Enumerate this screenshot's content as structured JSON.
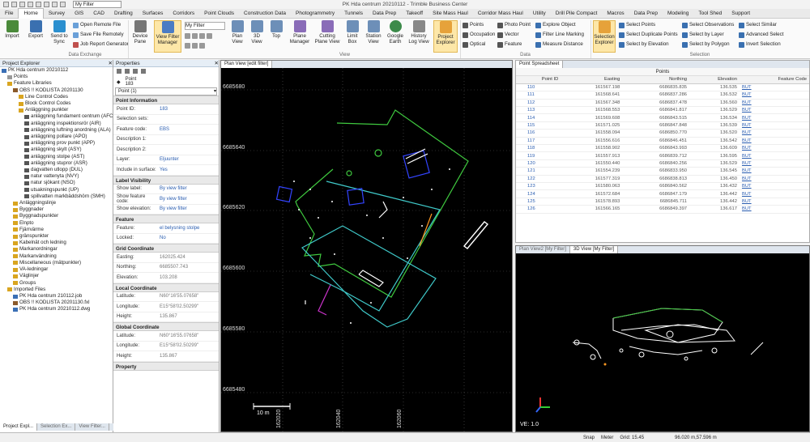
{
  "app": {
    "title": "PK Hda centrum 20210112 - Trimble Business Center",
    "filter": "My Filter"
  },
  "menu": [
    "File",
    "Home",
    "Survey",
    "GIS",
    "CAD",
    "Drafting",
    "Surfaces",
    "Corridors",
    "Point Clouds",
    "Construction Data",
    "Photogrammetry",
    "Tunnels",
    "Data Prep",
    "Takeoff",
    "Site Mass Haul",
    "Corridor Mass Haul",
    "Utility",
    "Drill Pile Compact",
    "Macros",
    "Data Prep",
    "Modeling",
    "Tool Shed",
    "Support"
  ],
  "ribbon": {
    "import": "Import",
    "export": "Export",
    "send": "Send to Sync",
    "remote": "Open Remote File",
    "save_remotely": "Save File Remotely",
    "job_report": "Job Report Generator",
    "device": "Device Pane",
    "view_filter": "View Filter Manager",
    "myfilter": "My Filter",
    "plan": "Plan View",
    "view3d": "3D View",
    "top": "Top",
    "plane_mgr": "Plane Manager",
    "cutting": "Cutting Plane View",
    "limit_box": "Limit Box",
    "station": "Station View",
    "gearth": "Google Earth",
    "history": "History Log View",
    "proj_exp": "Project Explorer",
    "points": "Points",
    "occupation": "Occupation",
    "optical": "Optical",
    "photo_point": "Photo Point",
    "vector": "Vector",
    "feature": "Feature",
    "explore_obj": "Explore Object",
    "filter_line": "Filter Line Marking",
    "measure_dist": "Measure Distance",
    "selection_exp": "Selection Explorer",
    "sel_points": "Select Points",
    "sel_dup": "Select Duplicate Points",
    "sel_elev": "Select by Elevation",
    "sel_obs": "Select Observations",
    "sel_layer": "Select by Layer",
    "sel_poly": "Select by Polygon",
    "sel_similar": "Select Similar",
    "adv_sel": "Advanced Select",
    "inv_sel": "Invert Selection",
    "grp_data_exchange": "Data Exchange",
    "grp_view": "View",
    "grp_data": "Data",
    "grp_selection": "Selection"
  },
  "project_explorer": {
    "title": "Project Explorer",
    "items": [
      {
        "t": "PK Hda centrum 20210112",
        "lvl": 0,
        "c": "#3a6fb5"
      },
      {
        "t": "Points",
        "lvl": 1,
        "c": "#999"
      },
      {
        "t": "Feature Libraries",
        "lvl": 1,
        "c": "#d9a520"
      },
      {
        "t": "OBS !! KODLISTA 20201130",
        "lvl": 2,
        "c": "#8b5a2b"
      },
      {
        "t": "Line Control Codes",
        "lvl": 3,
        "c": "#d9a520"
      },
      {
        "t": "Block Control Codes",
        "lvl": 3,
        "c": "#d9a520"
      },
      {
        "t": "Anläggning punkter",
        "lvl": 3,
        "c": "#d9a520"
      },
      {
        "t": "anläggning fundament centrum (AFC)",
        "lvl": 4,
        "c": "#555"
      },
      {
        "t": "anläggning inspektionsrör (AIR)",
        "lvl": 4,
        "c": "#555"
      },
      {
        "t": "anläggning luftning anordning (ALA)",
        "lvl": 4,
        "c": "#555"
      },
      {
        "t": "anläggning pollare (APO)",
        "lvl": 4,
        "c": "#555"
      },
      {
        "t": "anläggning prov punkt (APP)",
        "lvl": 4,
        "c": "#555"
      },
      {
        "t": "anläggning skylt (ASY)",
        "lvl": 4,
        "c": "#555"
      },
      {
        "t": "anläggning stolpe (AST)",
        "lvl": 4,
        "c": "#555"
      },
      {
        "t": "anläggning stupror (ASR)",
        "lvl": 4,
        "c": "#555"
      },
      {
        "t": "dagvatten utlopp (DUL)",
        "lvl": 4,
        "c": "#555"
      },
      {
        "t": "natur vattenyta (NVY)",
        "lvl": 4,
        "c": "#555"
      },
      {
        "t": "natur sjökant (NSO)",
        "lvl": 4,
        "c": "#555"
      },
      {
        "t": "utsakningspunkt (UP)",
        "lvl": 4,
        "c": "#555"
      },
      {
        "t": "spillvatten markbäddshörn (SMH)",
        "lvl": 4,
        "c": "#555"
      },
      {
        "t": "Anläggningslinje",
        "lvl": 2,
        "c": "#d9a520"
      },
      {
        "t": "Byggnader",
        "lvl": 2,
        "c": "#d9a520"
      },
      {
        "t": "Byggnadspunkter",
        "lvl": 2,
        "c": "#d9a520"
      },
      {
        "t": "Elnpto",
        "lvl": 2,
        "c": "#d9a520"
      },
      {
        "t": "Fjärrvärme",
        "lvl": 2,
        "c": "#d9a520"
      },
      {
        "t": "gränspunkter",
        "lvl": 2,
        "c": "#d9a520"
      },
      {
        "t": "Kabelnät och ledning",
        "lvl": 2,
        "c": "#d9a520"
      },
      {
        "t": "Markanordningar",
        "lvl": 2,
        "c": "#d9a520"
      },
      {
        "t": "Markanvändning",
        "lvl": 2,
        "c": "#d9a520"
      },
      {
        "t": "Miscellaneous (mätpunkter)",
        "lvl": 2,
        "c": "#d9a520"
      },
      {
        "t": "VA-ledningar",
        "lvl": 2,
        "c": "#d9a520"
      },
      {
        "t": "Väglinjer",
        "lvl": 2,
        "c": "#d9a520"
      },
      {
        "t": "Groups",
        "lvl": 2,
        "c": "#d9a520"
      },
      {
        "t": "Imported Files",
        "lvl": 1,
        "c": "#d9a520"
      },
      {
        "t": "PK Hda centrum 210112.job",
        "lvl": 2,
        "c": "#3a6fb5"
      },
      {
        "t": "OBS !! KODLISTA 20201130.fxl",
        "lvl": 2,
        "c": "#8b5a2b"
      },
      {
        "t": "PK Hda centrum 20210112.dwg",
        "lvl": 2,
        "c": "#3a6fb5"
      }
    ],
    "bottom_tabs": [
      "Project Expl...",
      "Selection Ex...",
      "View Filter..."
    ]
  },
  "properties": {
    "title": "Properties",
    "point_label": "Point",
    "point_id": "183",
    "selector": "Point (1)",
    "sections": [
      {
        "name": "Point Information",
        "rows": [
          [
            "Point ID:",
            "183",
            ""
          ],
          [
            "Selection sets:",
            "",
            ""
          ],
          [
            "Feature code:",
            "EBS",
            ""
          ],
          [
            "Description 1:",
            "",
            ""
          ],
          [
            "Description 2:",
            "",
            ""
          ],
          [
            "Layer:",
            "Eljuunter",
            ""
          ],
          [
            "Include in surface:",
            "Yes",
            ""
          ]
        ]
      },
      {
        "name": "Label Visibility",
        "rows": [
          [
            "Show label:",
            "By view filter",
            ""
          ],
          [
            "Show feature code:",
            "By view filter",
            ""
          ],
          [
            "Show elevation:",
            "By view filter",
            ""
          ]
        ]
      },
      {
        "name": "Feature",
        "rows": [
          [
            "Feature:",
            "el belysning stolpe",
            ""
          ],
          [
            "Locked:",
            "No",
            ""
          ]
        ]
      },
      {
        "name": "Grid Coordinate",
        "rows": [
          [
            "Easting:",
            "162025.424",
            "g"
          ],
          [
            "Northing:",
            "6685507.743",
            "g"
          ],
          [
            "Elevation:",
            "103.208",
            "g"
          ]
        ]
      },
      {
        "name": "Local Coordinate",
        "rows": [
          [
            "Latitude:",
            "N60°16'55.07658\"",
            "g"
          ],
          [
            "Longitude:",
            "E15°58'02.50299\"",
            "g"
          ],
          [
            "Height:",
            "135.867",
            "g"
          ]
        ]
      },
      {
        "name": "Global Coordinate",
        "rows": [
          [
            "Latitude:",
            "N60°16'55.07658\"",
            "g"
          ],
          [
            "Longitude:",
            "E15°58'02.50299\"",
            "g"
          ],
          [
            "Height:",
            "135.867",
            "g"
          ]
        ]
      },
      {
        "name": "Property",
        "rows": []
      }
    ]
  },
  "plan_view": {
    "tab": "Plan View [edit filter]",
    "northings": [
      "6685680",
      "6685640",
      "6685620",
      "6685600",
      "6685580",
      "6685480"
    ],
    "eastings": [
      "162020",
      "162040",
      "162060"
    ],
    "scale": "10 m"
  },
  "spreadsheet": {
    "tab": "Point Spreadsheet",
    "group": "Points",
    "headers": [
      "Point ID",
      "Easting",
      "Northing",
      "Elevation",
      "Feature Code"
    ],
    "rows": [
      [
        "110",
        "161567.198",
        "6686835.835",
        "136.535",
        "BUT"
      ],
      [
        "111",
        "161568.641",
        "6686837.286",
        "136.532",
        "BUT"
      ],
      [
        "112",
        "161567.348",
        "6686837.478",
        "136.560",
        "BUT"
      ],
      [
        "113",
        "161568.553",
        "6686841.817",
        "136.529",
        "BUT"
      ],
      [
        "114",
        "161569.608",
        "6686843.515",
        "136.534",
        "BUT"
      ],
      [
        "115",
        "161571.025",
        "6686847.848",
        "136.539",
        "BUT"
      ],
      [
        "116",
        "161558.094",
        "6686850.770",
        "136.520",
        "BUT"
      ],
      [
        "117",
        "161556.616",
        "6686846.451",
        "136.542",
        "BUT"
      ],
      [
        "118",
        "161558.902",
        "6686843.993",
        "136.609",
        "BUT"
      ],
      [
        "119",
        "161557.913",
        "6686839.712",
        "136.595",
        "BUT"
      ],
      [
        "120",
        "161550.440",
        "6686840.256",
        "136.529",
        "BUT"
      ],
      [
        "121",
        "161554.239",
        "6686833.950",
        "136.545",
        "BUT"
      ],
      [
        "122",
        "161577.319",
        "6686838.813",
        "136.450",
        "BUT"
      ],
      [
        "123",
        "161580.063",
        "6686840.562",
        "136.432",
        "BUT"
      ],
      [
        "124",
        "161572.684",
        "6686847.179",
        "136.442",
        "BUT"
      ],
      [
        "125",
        "161578.893",
        "6686845.711",
        "136.442",
        "BUT"
      ],
      [
        "126",
        "161566.165",
        "6686849.397",
        "136.617",
        "BUT"
      ]
    ]
  },
  "view3d": {
    "tabs": [
      "Plan View2 [My Filter]",
      "3D View [My Filter]"
    ],
    "ve": "VE: 1.0"
  },
  "status": {
    "snap": "Snap",
    "meter": "Meter",
    "grid": "Grid: 15.45",
    "coords": "96.020 m,57.596 m"
  }
}
